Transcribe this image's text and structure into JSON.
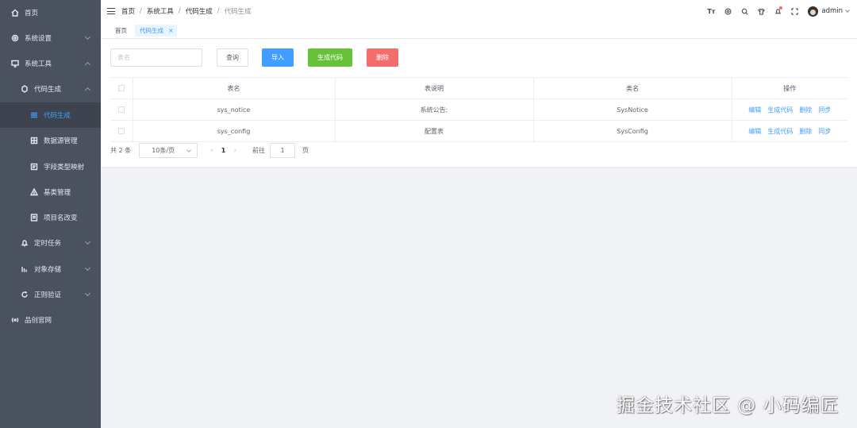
{
  "sidebar": {
    "items": [
      {
        "label": "首页",
        "icon": "home-icon"
      },
      {
        "label": "系统设置",
        "icon": "gear-icon"
      },
      {
        "label": "系统工具",
        "icon": "monitor-icon"
      },
      {
        "label": "代码生成",
        "icon": "code-icon"
      },
      {
        "label": "代码生成",
        "icon": "list-icon"
      },
      {
        "label": "数据源管理",
        "icon": "database-icon"
      },
      {
        "label": "字段类型映射",
        "icon": "field-icon"
      },
      {
        "label": "基类管理",
        "icon": "tree-icon"
      },
      {
        "label": "项目名改变",
        "icon": "doc-icon"
      },
      {
        "label": "定时任务",
        "icon": "bell-icon"
      },
      {
        "label": "对象存储",
        "icon": "storage-icon"
      },
      {
        "label": "正则验证",
        "icon": "refresh-icon"
      },
      {
        "label": "品创官网",
        "icon": "signal-icon"
      }
    ]
  },
  "header": {
    "breadcrumb": [
      "首页",
      "系统工具",
      "代码生成",
      "代码生成"
    ],
    "font_icon_text": "Tт",
    "username": "admin"
  },
  "tags": {
    "home": "首页",
    "current": "代码生成",
    "close": "×"
  },
  "toolbar": {
    "search_placeholder": "表名",
    "query": "查询",
    "import": "导入",
    "generate": "生成代码",
    "delete": "删除"
  },
  "table": {
    "headers": [
      "表名",
      "表说明",
      "类名",
      "操作"
    ],
    "rows": [
      {
        "table_name": "sys_notice",
        "description": "系统公告;",
        "class_name": "SysNotice"
      },
      {
        "table_name": "sys_config",
        "description": "配置表",
        "class_name": "SysConfig"
      }
    ],
    "actions": [
      "编辑",
      "生成代码",
      "删除",
      "同步"
    ]
  },
  "pagination": {
    "total": "共 2 条",
    "page_size": "10条/页",
    "prev": "‹",
    "current_page": "1",
    "next": "›",
    "goto_label": "前往",
    "goto_value": "1",
    "page_unit": "页"
  },
  "watermark": "掘金技术社区 @ 小码编匠"
}
